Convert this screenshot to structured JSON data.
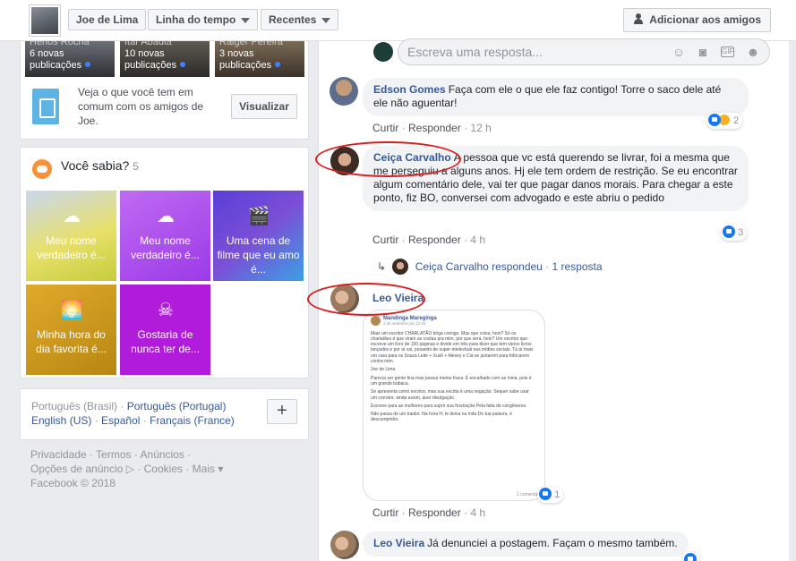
{
  "header": {
    "profile_name": "Joe de Lima",
    "timeline": "Linha do tempo",
    "recent": "Recentes",
    "add_friend": "Adicionar aos amigos"
  },
  "friends_tiles": [
    {
      "name": "Henos Rocha",
      "count": "6 novas",
      "sub": "publicações"
    },
    {
      "name": "Itar Abadia",
      "count": "10 novas",
      "sub": "publicações"
    },
    {
      "name": "Raiger Pereira",
      "count": "3 novas",
      "sub": "publicações"
    }
  ],
  "common": {
    "text": "Veja o que você tem em comum com os amigos de Joe.",
    "button": "Visualizar"
  },
  "sabia": {
    "title": "Você sabia?",
    "count": "5",
    "tiles": [
      {
        "label": "Meu nome verdadeiro é...",
        "icon": "☁"
      },
      {
        "label": "Meu nome verdadeiro é...",
        "icon": "☁"
      },
      {
        "label": "Uma cena de filme que eu amo é...",
        "icon": "🎬"
      },
      {
        "label": "Minha hora do dia favorita é...",
        "icon": "🌅"
      },
      {
        "label": "Gostaria de nunca ter de...",
        "icon": "☠"
      }
    ]
  },
  "languages": {
    "current": "Português (Brasil)",
    "others": [
      "Português (Portugal)",
      "English (US)",
      "Español",
      "Français (France)"
    ],
    "sep": "·"
  },
  "footer": {
    "line1": [
      "Privacidade",
      "Termos",
      "Anúncios"
    ],
    "line2": [
      "Opções de anúncio",
      "Cookies",
      "Mais"
    ],
    "copyright": "Facebook © 2018"
  },
  "reply_placeholder": "Escreva uma resposta...",
  "comments": [
    {
      "author": "Edson Gomes",
      "text": "Faça com ele o que ele faz contigo! Torre o saco dele até ele não aguentar!",
      "curtir": "Curtir",
      "responder": "Responder",
      "time": "12 h",
      "reactions": "2"
    },
    {
      "author": "Ceiça Carvalho",
      "text": "A pessoa que vc está querendo se livrar, foi a mesma que me perseguiu a alguns anos. Hj ele tem ordem de restrição. Se eu encontrar algum comentário dele, vai ter que pagar danos morais. Para chegar a este ponto, fiz BO, conversei com advogado e este abriu o pedido",
      "curtir": "Curtir",
      "responder": "Responder",
      "time": "4 h",
      "reactions": "3",
      "replied_by": "Ceiça Carvalho respondeu",
      "replies": "1 resposta"
    },
    {
      "author": "Leo Vieira",
      "curtir": "Curtir",
      "responder": "Responder",
      "time": "4 h",
      "embedded": {
        "name": "Mandinga Mareginga",
        "date": "2 de setembro às 12:34",
        "body": [
          "Mais um escritor CHARLATÃO briga comigo. Mas que coisa, hein? Só os charlatães é que viram as costas pra mim, por que será, hein? Um escritor que escreve um livro de 150 páginas e divide em três para dizer que tem vários livros lançados e por aí vai, posando de super-intelectual nas mídias sociais. Tá aí mais um cara para os Souza Leite + Xuxê + Alexey e Cia se juntarem para fofocarem contra mim.",
          "Joe de Lima",
          "Parecia ser gente fina mas possui mente fraca. É encalhado com as mina. pois é um grande babaca.",
          "Se apresenta como escritor, mas sua escrita é uma negação. Sequer sabe usar um corretor, ainda assim, quer divulgação.",
          "Escreve para as mulheres para suprir sua frustração Pela falta de congêneres.",
          "Não passa de um traidor. Na hora H, te deixa na mão De tua palavra, é descumpridor."
        ],
        "reactions": "1 comentá",
        "like_count": "1"
      }
    },
    {
      "author": "Leo Vieira",
      "text": "Já denunciei a postagem. Façam o mesmo também."
    }
  ]
}
